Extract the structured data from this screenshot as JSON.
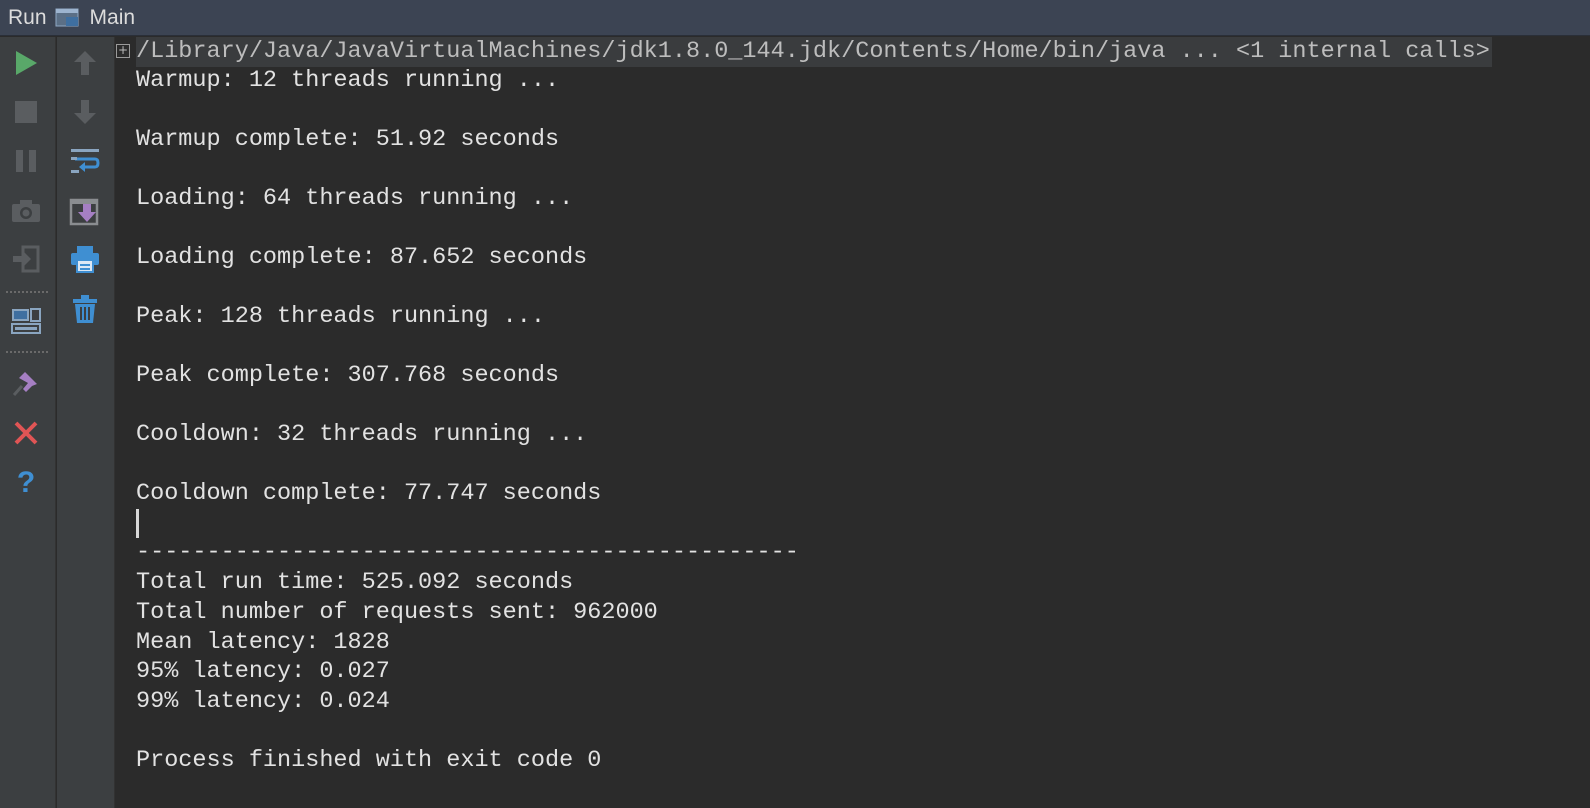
{
  "titlebar": {
    "run_label": "Run",
    "config_label": "Main"
  },
  "left_toolbar": [
    {
      "name": "run-icon",
      "color": "#59a869"
    },
    {
      "name": "stop-icon",
      "color": "#5a5d60"
    },
    {
      "name": "pause-icon",
      "color": "#5a5d60"
    },
    {
      "name": "camera-icon",
      "color": "#5a5d60"
    },
    {
      "name": "exit-icon",
      "color": "#5a5d60"
    },
    {
      "name": "layout-icon",
      "color": "#8aa5c0"
    },
    {
      "name": "pin-icon",
      "color": "#a57fc3"
    },
    {
      "name": "close-icon",
      "color": "#e05555"
    },
    {
      "name": "help-icon",
      "color": "#3f8fd2"
    }
  ],
  "right_toolbar": [
    {
      "name": "up-arrow-icon"
    },
    {
      "name": "down-arrow-icon"
    },
    {
      "name": "soft-wrap-icon"
    },
    {
      "name": "scroll-to-end-icon"
    },
    {
      "name": "print-icon"
    },
    {
      "name": "trash-icon"
    }
  ],
  "console": {
    "command": "/Library/Java/JavaVirtualMachines/jdk1.8.0_144.jdk/Contents/Home/bin/java ... <1 internal calls>",
    "lines": [
      "Warmup: 12 threads running ...",
      "",
      "Warmup complete: 51.92 seconds",
      "",
      "Loading: 64 threads running ...",
      "",
      "Loading complete: 87.652 seconds",
      "",
      "Peak: 128 threads running ...",
      "",
      "Peak complete: 307.768 seconds",
      "",
      "Cooldown: 32 threads running ...",
      "",
      "Cooldown complete: 77.747 seconds",
      "",
      "-----------------------------------------------",
      "Total run time: 525.092 seconds",
      "Total number of requests sent: 962000",
      "Mean latency: 1828",
      "95% latency: 0.027",
      "99% latency: 0.024",
      "",
      "Process finished with exit code 0"
    ]
  }
}
